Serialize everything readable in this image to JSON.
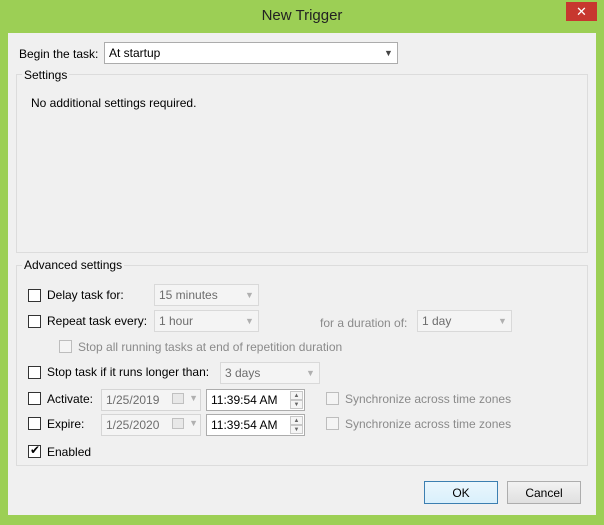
{
  "window": {
    "title": "New Trigger",
    "close_glyph": "✕"
  },
  "begin": {
    "label": "Begin the task:",
    "value": "At startup"
  },
  "settings": {
    "legend": "Settings",
    "message": "No additional settings required."
  },
  "advanced": {
    "legend": "Advanced settings",
    "delay": {
      "label": "Delay task for:",
      "value": "15 minutes",
      "checked": false
    },
    "repeat": {
      "label": "Repeat task every:",
      "value": "1 hour",
      "duration_label": "for a duration of:",
      "duration_value": "1 day",
      "checked": false
    },
    "stop_running": {
      "label": "Stop all running tasks at end of repetition duration",
      "checked": false
    },
    "stop_longer": {
      "label": "Stop task if it runs longer than:",
      "value": "3 days",
      "checked": false
    },
    "activate": {
      "label": "Activate:",
      "date": "1/25/2019",
      "time": "11:39:54 AM",
      "sync_label": "Synchronize across time zones",
      "checked": false
    },
    "expire": {
      "label": "Expire:",
      "date": "1/25/2020",
      "time": "11:39:54 AM",
      "sync_label": "Synchronize across time zones",
      "checked": false
    },
    "enabled": {
      "label": "Enabled",
      "checked": true,
      "tick": "✔"
    }
  },
  "buttons": {
    "ok": "OK",
    "cancel": "Cancel"
  }
}
